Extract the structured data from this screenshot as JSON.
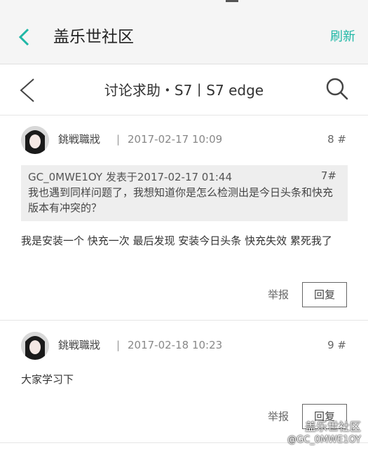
{
  "app": {
    "title": "盖乐世社区",
    "refresh_label": "刷新",
    "accent_color": "#1fb7a6"
  },
  "thread": {
    "title": "讨论求助・S7丨S7 edge"
  },
  "posts": [
    {
      "username": "銚戦職戕",
      "separator": "|",
      "time": "2017-02-17 10:09",
      "floor": "8 #",
      "quote": {
        "author_line": "GC_0MWE1OY 发表于2017-02-17 01:44",
        "floor": "7#",
        "text": "我也遇到同样问题了，我想知道你是怎么检测出是今日头条和快充版本有冲突的？"
      },
      "content": "我是安装一个 快充一次 最后发现 安装今日头条 快充失效 累死我了",
      "report_label": "举报",
      "reply_label": "回复"
    },
    {
      "username": "銚戦職戕",
      "separator": "|",
      "time": "2017-02-18 10:23",
      "floor": "9 #",
      "content": "大家学习下",
      "report_label": "举报",
      "reply_label": "回复"
    }
  ],
  "watermark": {
    "brand": "盖乐世社区",
    "handle": "@GC_0MWE1OY"
  }
}
